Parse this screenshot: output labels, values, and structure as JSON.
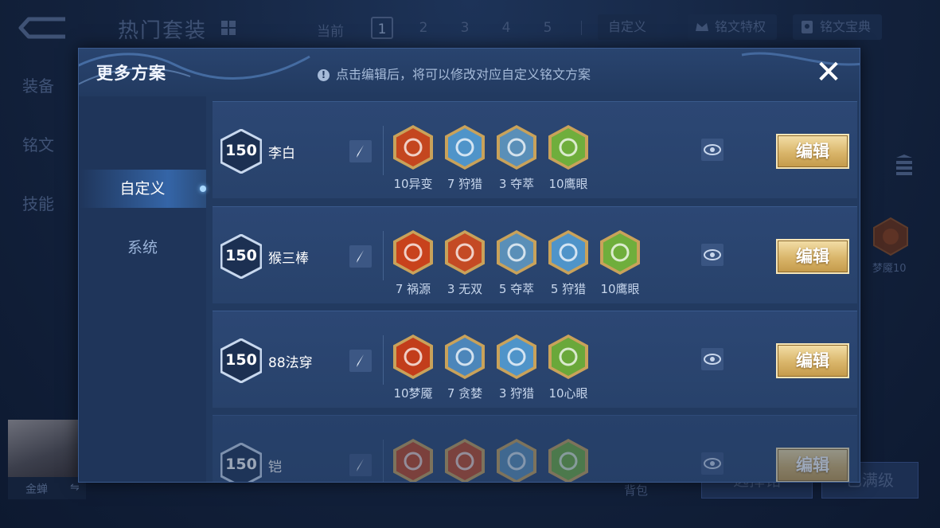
{
  "background": {
    "title": "热门套装",
    "current_label": "当前",
    "pages": [
      "1",
      "2",
      "3",
      "4",
      "5"
    ],
    "active_page": "1",
    "custom_label": "自定义",
    "rune_privilege": "铭文特权",
    "rune_codex": "铭文宝典",
    "side_items": [
      "装备",
      "铭文",
      "技能"
    ],
    "right_rune_label": "梦魇10",
    "hero_name": "金蝉",
    "bag_label": "背包",
    "button_left": "选择铭",
    "button_right": "已满级"
  },
  "modal": {
    "title": "更多方案",
    "hint": "点击编辑后，将可以修改对应自定义铭文方案",
    "close_label": "✕",
    "tabs": [
      {
        "label": "自定义",
        "active": true
      },
      {
        "label": "系统",
        "active": false
      }
    ],
    "edit_label": "编辑",
    "plans": [
      {
        "level": "150",
        "name": "李白",
        "runes": [
          {
            "label": "10异变",
            "icon": "rune-red-icon",
            "color": "#c4461f"
          },
          {
            "label": "7 狩猎",
            "icon": "rune-blue-lightning-icon",
            "color": "#4f94c9"
          },
          {
            "label": "3 夺萃",
            "icon": "rune-blue-knot-icon",
            "color": "#5a8fb8"
          },
          {
            "label": "10鹰眼",
            "icon": "rune-green-icon",
            "color": "#6fae3c"
          }
        ]
      },
      {
        "level": "150",
        "name": "猴三棒",
        "runes": [
          {
            "label": "7 祸源",
            "icon": "rune-red-icon",
            "color": "#c8421c"
          },
          {
            "label": "3 无双",
            "icon": "rune-red-icon",
            "color": "#c44a24"
          },
          {
            "label": "5 夺萃",
            "icon": "rune-blue-knot-icon",
            "color": "#5a8fb8"
          },
          {
            "label": "5 狩猎",
            "icon": "rune-blue-lightning-icon",
            "color": "#4f94c9"
          },
          {
            "label": "10鹰眼",
            "icon": "rune-green-icon",
            "color": "#6fae3c"
          }
        ]
      },
      {
        "level": "150",
        "name": "88法穿",
        "runes": [
          {
            "label": "10梦魇",
            "icon": "rune-red-icon",
            "color": "#c23d1b"
          },
          {
            "label": "7 贪婪",
            "icon": "rune-blue-star-icon",
            "color": "#4c86ba"
          },
          {
            "label": "3 狩猎",
            "icon": "rune-blue-lightning-icon",
            "color": "#4f94c9"
          },
          {
            "label": "10心眼",
            "icon": "rune-green-icon",
            "color": "#6aa83a"
          }
        ]
      },
      {
        "level": "150",
        "name": "铠",
        "runes": [
          {
            "label": "",
            "icon": "rune-red-icon",
            "color": "#c4461f"
          },
          {
            "label": "",
            "icon": "rune-red-icon",
            "color": "#c44a24"
          },
          {
            "label": "",
            "icon": "rune-blue-knot-icon",
            "color": "#5a8fb8"
          },
          {
            "label": "",
            "icon": "rune-green-icon",
            "color": "#6fae3c"
          }
        ]
      }
    ]
  }
}
